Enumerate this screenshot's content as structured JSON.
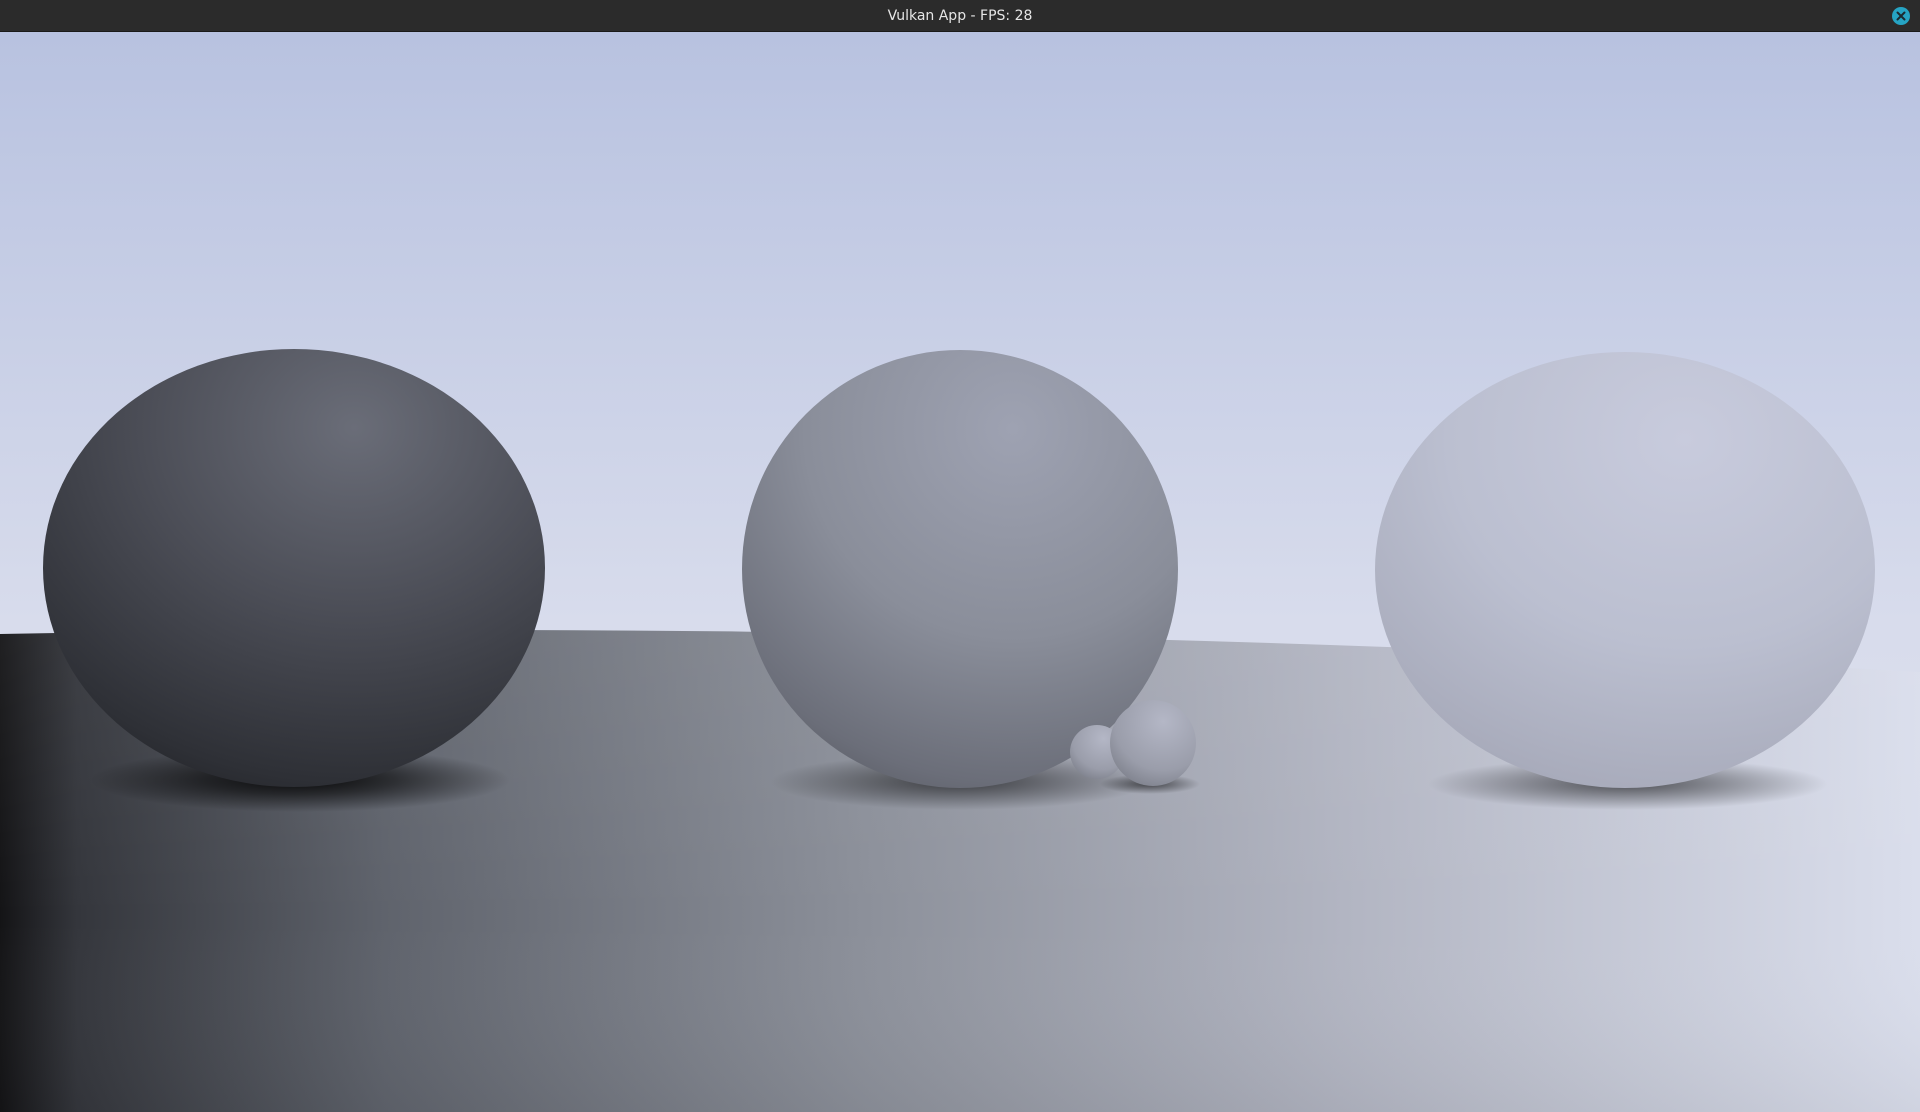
{
  "window": {
    "title": "Vulkan App - FPS: 28",
    "close_icon": "close-icon",
    "close_color": "#26a4c4"
  },
  "scene": {
    "sky_top_color": "#b8c2e0",
    "sky_horizon_color": "#dde1ef",
    "floor_near_color": "#8c8c8c",
    "spheres": [
      {
        "name": "dark-sphere",
        "shade": "dark"
      },
      {
        "name": "mid-sphere",
        "shade": "medium"
      },
      {
        "name": "light-sphere",
        "shade": "light"
      },
      {
        "name": "small-sphere-back",
        "shade": "medium"
      },
      {
        "name": "small-sphere-front",
        "shade": "medium"
      }
    ]
  }
}
